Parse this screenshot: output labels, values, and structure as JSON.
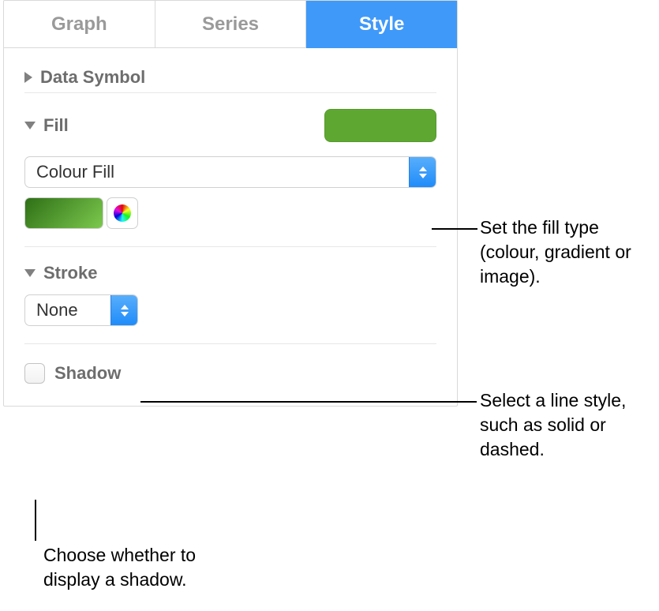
{
  "tabs": {
    "graph": "Graph",
    "series": "Series",
    "style": "Style"
  },
  "sections": {
    "dataSymbol": {
      "title": "Data Symbol"
    },
    "fill": {
      "title": "Fill",
      "swatchColor": "#5ea832",
      "popup": "Colour Fill"
    },
    "stroke": {
      "title": "Stroke",
      "popup": "None"
    },
    "shadow": {
      "title": "Shadow"
    }
  },
  "callouts": {
    "fill": "Set the fill type (colour, gradient or image).",
    "stroke": "Select a line style, such as solid or dashed.",
    "shadow": "Choose whether to display a shadow."
  }
}
